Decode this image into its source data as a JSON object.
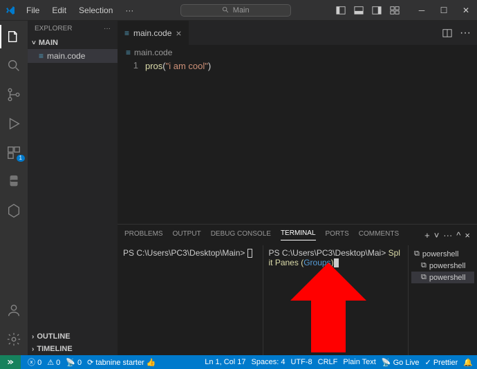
{
  "menu": {
    "file": "File",
    "edit": "Edit",
    "selection": "Selection",
    "more": "···"
  },
  "title": {
    "search_text": "Main"
  },
  "sidebar": {
    "header": "EXPLORER",
    "project": "MAIN",
    "file": "main.code",
    "outline": "OUTLINE",
    "timeline": "TIMELINE"
  },
  "editor": {
    "tab": "main.code",
    "breadcrumb": "main.code",
    "line_num": "1",
    "code_call": "pros",
    "code_paren_open": "(",
    "code_string": "\"i am cool\"",
    "code_paren_close": ")"
  },
  "panel": {
    "tabs": {
      "problems": "PROBLEMS",
      "output": "OUTPUT",
      "debug": "DEBUG CONSOLE",
      "terminal": "TERMINAL",
      "ports": "PORTS",
      "comments": "COMMENTS"
    },
    "term1_prompt": "PS C:\\Users\\PC3\\Desktop\\Main> ",
    "term2_line1a": "PS C:\\Users\\PC3\\Desktop\\Mai> ",
    "term2_line1b": "Spl",
    "term2_line2a": "it Panes (",
    "term2_line2b": "Groups",
    "term2_line2c": ")",
    "list": [
      "powershell",
      "powershell",
      "powershell"
    ]
  },
  "status": {
    "errors": "0",
    "warnings": "0",
    "ports": "0",
    "tabnine": "tabnine starter",
    "line_col": "Ln 1, Col 17",
    "spaces": "Spaces: 4",
    "encoding": "UTF-8",
    "eol": "CRLF",
    "lang": "Plain Text",
    "golive": "Go Live",
    "prettier": "Prettier"
  },
  "activity": {
    "ext_badge": "1"
  }
}
